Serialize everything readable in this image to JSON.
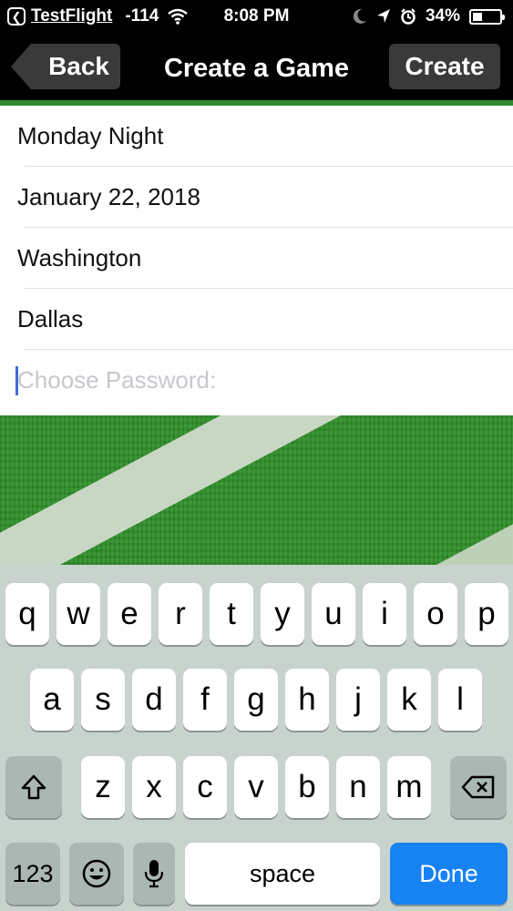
{
  "status_bar": {
    "back_app_icon": "back-arrow-icon",
    "app_name": "TestFlight",
    "signal": "-114",
    "time": "8:08 PM",
    "battery_percent": "34%",
    "battery_level": 0.34,
    "icons": [
      "wifi-icon",
      "moon-icon",
      "location-arrow-icon",
      "alarm-icon",
      "battery-icon"
    ]
  },
  "nav": {
    "back_label": "Back",
    "title": "Create a Game",
    "create_label": "Create"
  },
  "form": {
    "fields": [
      {
        "value": "Monday Night"
      },
      {
        "value": "January 22, 2018"
      },
      {
        "value": "Washington"
      },
      {
        "value": "Dallas"
      }
    ],
    "password_placeholder": "Choose Password:"
  },
  "keyboard": {
    "row1": [
      "q",
      "w",
      "e",
      "r",
      "t",
      "y",
      "u",
      "i",
      "o",
      "p"
    ],
    "row2": [
      "a",
      "s",
      "d",
      "f",
      "g",
      "h",
      "j",
      "k",
      "l"
    ],
    "row3": [
      "z",
      "x",
      "c",
      "v",
      "b",
      "n",
      "m"
    ],
    "numbers_label": "123",
    "space_label": "space",
    "done_label": "Done",
    "icons": [
      "shift-icon",
      "backspace-icon",
      "emoji-icon",
      "microphone-icon"
    ]
  },
  "colors": {
    "nav_background": "#000000",
    "accent_green": "#2e8a2e",
    "done_blue": "#1782f2",
    "keyboard_background": "#c8d3ce"
  }
}
